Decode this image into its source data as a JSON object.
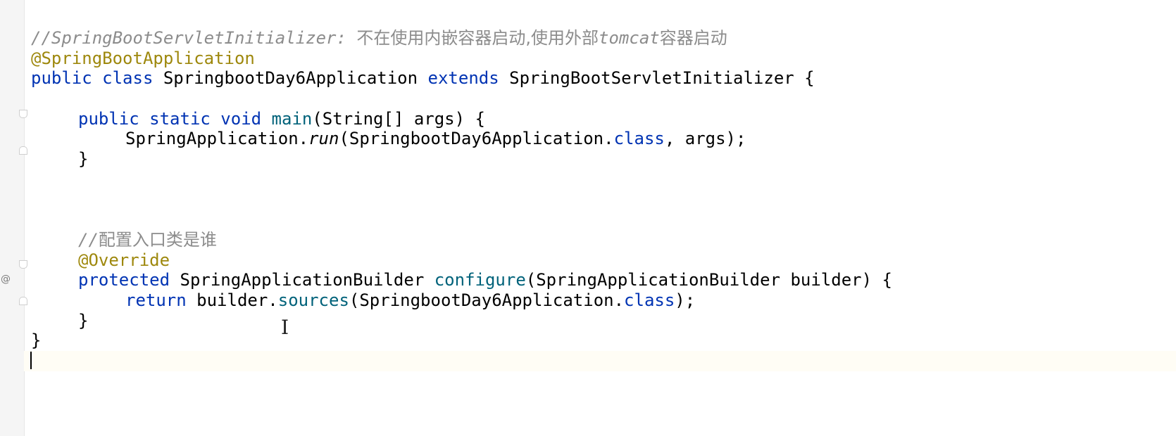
{
  "editor": {
    "lines": [
      {
        "parts": [
          "//SpringBootServletInitializer: ",
          "不在使用内嵌容器启动,使用外部",
          "tomcat",
          "容器启动"
        ]
      },
      {
        "parts": [
          "@SpringBootApplication"
        ]
      },
      {
        "parts": [
          "public class",
          " SpringbootDay6Application ",
          "extends",
          " SpringBootServletInitializer {"
        ]
      },
      {
        "parts": [
          ""
        ]
      },
      {
        "parts": [
          "public static void",
          " ",
          "main",
          "(String[] args) {"
        ]
      },
      {
        "parts": [
          "SpringApplication.",
          "run",
          "(SpringbootDay6Application.",
          "class",
          ", args);"
        ]
      },
      {
        "parts": [
          "}"
        ]
      },
      {
        "parts": [
          ""
        ]
      },
      {
        "parts": [
          ""
        ]
      },
      {
        "parts": [
          ""
        ]
      },
      {
        "parts": [
          "//",
          "配置入口类是谁"
        ]
      },
      {
        "parts": [
          "@Override"
        ]
      },
      {
        "parts": [
          "protected",
          " SpringApplicationBuilder ",
          "configure",
          "(SpringApplicationBuilder builder) {"
        ]
      },
      {
        "parts": [
          "return",
          " builder.",
          "sources",
          "(SpringbootDay6Application.",
          "class",
          ");"
        ]
      },
      {
        "parts": [
          "}"
        ]
      },
      {
        "parts": [
          "}"
        ]
      },
      {
        "parts": [
          ""
        ]
      }
    ],
    "gutter_marker": "@",
    "colors": {
      "comment": "#8c8c8c",
      "annotation": "#9e880d",
      "keyword": "#0033b3",
      "method": "#00627a",
      "text": "#000000",
      "background": "#ffffff",
      "current_line": "#fffdf5"
    }
  }
}
